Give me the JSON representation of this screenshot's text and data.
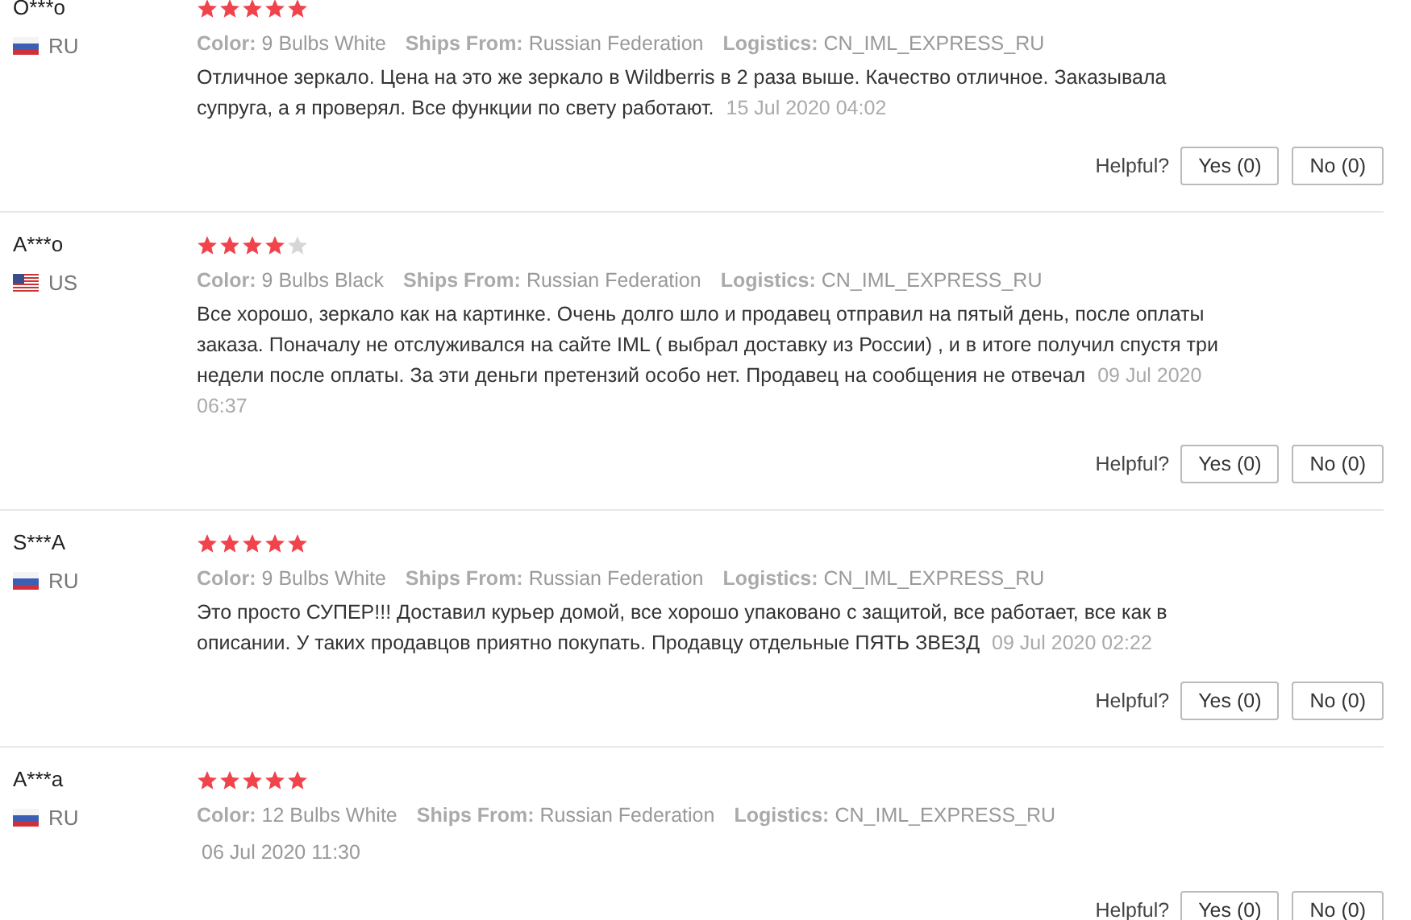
{
  "reviews": [
    {
      "name": "O***o",
      "country": "RU",
      "stars": 5,
      "color_label": "Color:",
      "variant": "9 Bulbs White",
      "ships_from_label": "Ships From:",
      "ships_from": "Russian Federation",
      "logistics_label": "Logistics:",
      "logistics": "CN_IML_EXPRESS_RU",
      "text": "Отличное зеркало. Цена на это же зеркало в Wildberris в 2 раза выше. Качество отличное. Заказывала супруга, а я проверял. Все функции по свету работают.",
      "date": "15 Jul 2020 04:02",
      "helpful_label": "Helpful?",
      "yes": "Yes (0)",
      "no": "No (0)"
    },
    {
      "name": "A***o",
      "country": "US",
      "stars": 4,
      "color_label": "Color:",
      "variant": "9 Bulbs Black",
      "ships_from_label": "Ships From:",
      "ships_from": "Russian Federation",
      "logistics_label": "Logistics:",
      "logistics": "CN_IML_EXPRESS_RU",
      "text": "Все хорошо, зеркало как на картинке. Очень долго шло и продавец отправил на пятый день, после оплаты заказа. Поначалу не отслуживался на сайте IML ( выбрал доставку из России) , и в итоге получил спустя три недели после оплаты. За эти деньги претензий особо нет. Продавец на сообщения не отвечал",
      "date": "09 Jul 2020 06:37",
      "helpful_label": "Helpful?",
      "yes": "Yes (0)",
      "no": "No (0)"
    },
    {
      "name": "S***A",
      "country": "RU",
      "stars": 5,
      "color_label": "Color:",
      "variant": "9 Bulbs White",
      "ships_from_label": "Ships From:",
      "ships_from": "Russian Federation",
      "logistics_label": "Logistics:",
      "logistics": "CN_IML_EXPRESS_RU",
      "text": "Это просто СУПЕР!!! Доставил курьер домой, все хорошо упаковано с защитой, все работает, все как в описании. У таких продавцов приятно покупать. Продавцу отдельные ПЯТЬ ЗВЕЗД",
      "date": "09 Jul 2020 02:22",
      "helpful_label": "Helpful?",
      "yes": "Yes (0)",
      "no": "No (0)"
    },
    {
      "name": "A***a",
      "country": "RU",
      "stars": 5,
      "color_label": "Color:",
      "variant": "12 Bulbs White",
      "ships_from_label": "Ships From:",
      "ships_from": "Russian Federation",
      "logistics_label": "Logistics:",
      "logistics": "CN_IML_EXPRESS_RU",
      "date": "06 Jul 2020 11:30",
      "helpful_label": "Helpful?",
      "yes": "Yes (0)",
      "no": "No (0)"
    }
  ]
}
